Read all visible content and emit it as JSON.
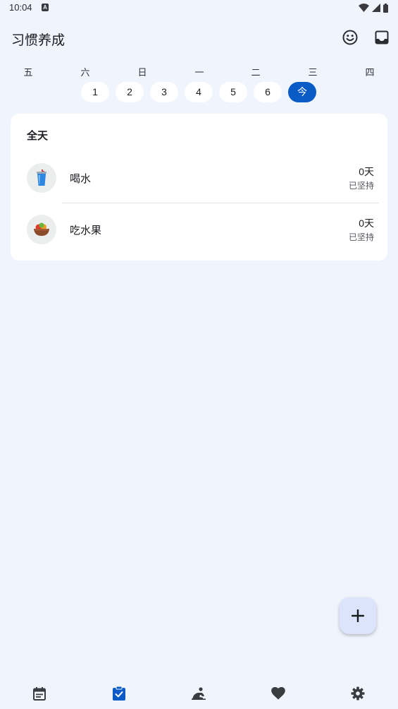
{
  "status_bar": {
    "time": "10:04",
    "notification_badge": "A"
  },
  "app_bar": {
    "title": "习惯养成",
    "icons": [
      "smiley-icon",
      "inbox-icon"
    ]
  },
  "week": {
    "weekdays": [
      "五",
      "六",
      "日",
      "一",
      "二",
      "三",
      "四"
    ],
    "dates": [
      "1",
      "2",
      "3",
      "4",
      "5",
      "6",
      "今"
    ],
    "selected_index": 6
  },
  "habits": {
    "section_title": "全天",
    "items": [
      {
        "name": "喝水",
        "days": "0天",
        "streak_label": "已坚持",
        "icon": "cup-icon"
      },
      {
        "name": "吃水果",
        "days": "0天",
        "streak_label": "已坚持",
        "icon": "fruit-bowl-icon"
      }
    ]
  },
  "fab": {
    "icon": "plus-icon"
  },
  "bottom_nav": {
    "items": [
      "calendar-icon",
      "clipboard-check-icon",
      "meditation-icon",
      "heart-icon",
      "gear-icon"
    ],
    "active_index": 1,
    "active_color": "#0b5bc6",
    "inactive_color": "#3b3c40"
  }
}
